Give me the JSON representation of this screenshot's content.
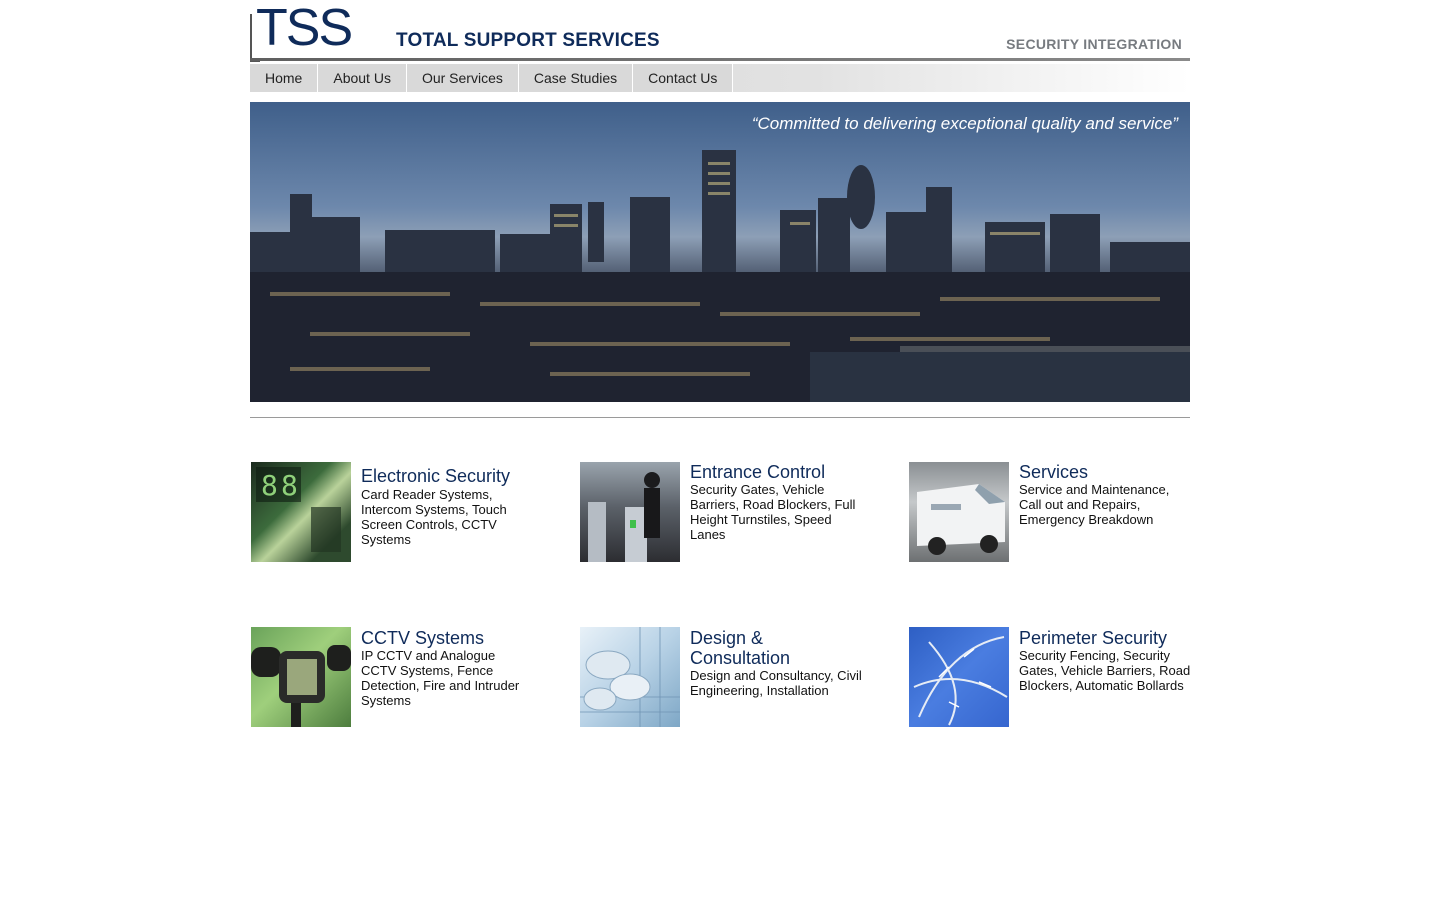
{
  "header": {
    "logo": "TSS",
    "company_name": "TOTAL SUPPORT SERVICES",
    "tagline": "SECURITY INTEGRATION"
  },
  "nav": {
    "items": [
      {
        "label": "Home"
      },
      {
        "label": "About Us"
      },
      {
        "label": "Our Services"
      },
      {
        "label": "Case Studies"
      },
      {
        "label": "Contact Us"
      }
    ]
  },
  "hero": {
    "quote": "“Committed to delivering exceptional quality and service”"
  },
  "services": [
    {
      "title": "Electronic Security",
      "description": "Card Reader Systems, Intercom Systems, Touch Screen Controls, CCTV Systems",
      "thumb": "keypad-photo"
    },
    {
      "title": "Entrance Control",
      "description": "Security Gates, Vehicle Barriers, Road Blockers, Full Height Turnstiles, Speed Lanes",
      "thumb": "turnstile-photo"
    },
    {
      "title": "Services",
      "description": "Service and Maintenance, Call out and Repairs, Emergency Breakdown",
      "thumb": "van-photo"
    },
    {
      "title": "CCTV Systems",
      "description": "IP CCTV and Analogue CCTV Systems, Fence Detection, Fire and Intruder Systems",
      "thumb": "camera-photo"
    },
    {
      "title": "Design & Consultation",
      "description": "Design and Consultancy, Civil Engineering, Installation",
      "thumb": "blueprint-photo"
    },
    {
      "title": "Perimeter Security",
      "description": "Security Fencing, Security Gates, Vehicle Barriers, Road Blockers, Automatic Bollards",
      "thumb": "razor-wire-photo"
    }
  ]
}
